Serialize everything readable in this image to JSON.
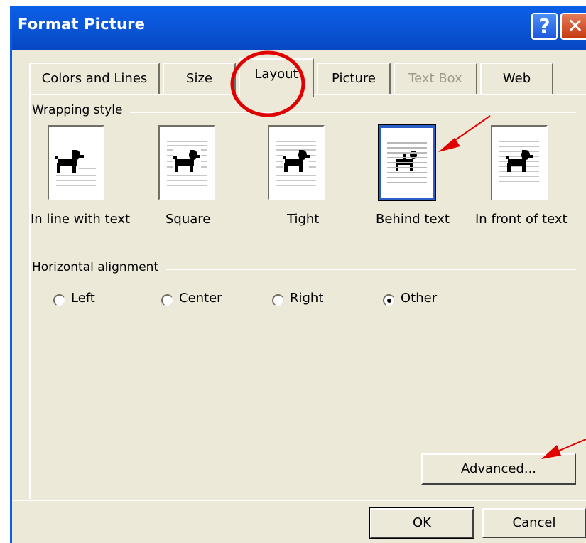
{
  "window": {
    "title": "Format Picture",
    "help_glyph": "?",
    "close_glyph": "✕"
  },
  "tabs": [
    {
      "label": "Colors and Lines",
      "state": "normal"
    },
    {
      "label": "Size",
      "state": "normal"
    },
    {
      "label": "Layout",
      "state": "active"
    },
    {
      "label": "Picture",
      "state": "normal"
    },
    {
      "label": "Text Box",
      "state": "disabled"
    },
    {
      "label": "Web",
      "state": "normal"
    }
  ],
  "wrapping": {
    "group_label": "Wrapping style",
    "options": [
      {
        "label": "In line with text",
        "icon": "inline-with-text-icon",
        "selected": false
      },
      {
        "label": "Square",
        "icon": "square-wrap-icon",
        "selected": false
      },
      {
        "label": "Tight",
        "icon": "tight-wrap-icon",
        "selected": false
      },
      {
        "label": "Behind text",
        "icon": "behind-text-icon",
        "selected": true
      },
      {
        "label": "In front of text",
        "icon": "in-front-of-text-icon",
        "selected": false
      }
    ]
  },
  "alignment": {
    "group_label": "Horizontal alignment",
    "options": [
      {
        "label": "Left",
        "checked": false
      },
      {
        "label": "Center",
        "checked": false
      },
      {
        "label": "Right",
        "checked": false
      },
      {
        "label": "Other",
        "checked": true
      }
    ]
  },
  "buttons": {
    "advanced": "Advanced...",
    "ok": "OK",
    "cancel": "Cancel"
  },
  "colors": {
    "titlebar": "#0a56d8",
    "dialog_bg": "#ece9d8",
    "selection_border": "#2b5fc8",
    "annotation": "#e00000"
  }
}
